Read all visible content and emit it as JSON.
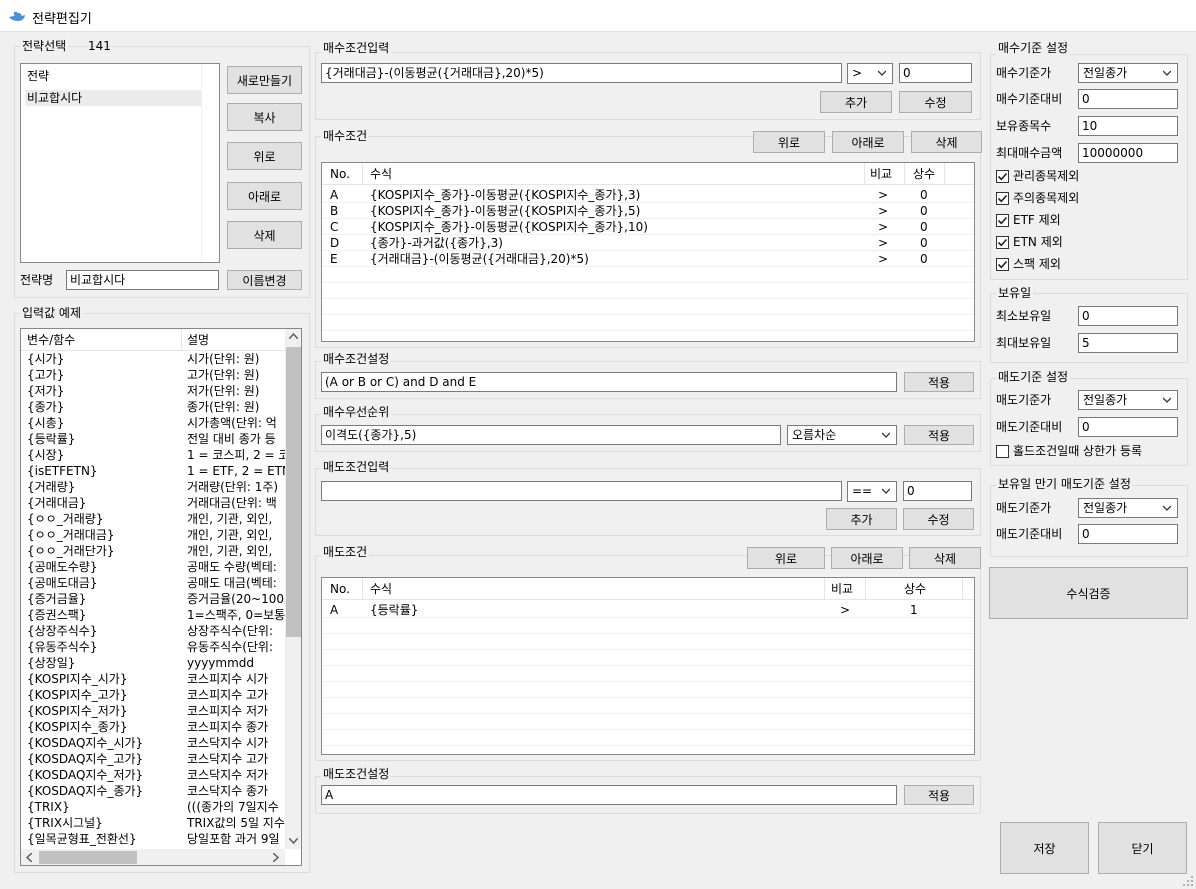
{
  "window": {
    "title": "전략편집기"
  },
  "strategy": {
    "group_label": "전략선택",
    "count": "141",
    "list_header": "전략",
    "items": [
      "비교합시다"
    ],
    "name_label": "전략명",
    "name_value": "비교합시다",
    "buttons": {
      "new": "새로만들기",
      "copy": "복사",
      "up": "위로",
      "down": "아래로",
      "delete": "삭제",
      "rename": "이름변경"
    }
  },
  "examples": {
    "group_label": "입력값 예제",
    "columns": [
      "변수/함수",
      "설명"
    ],
    "rows": [
      [
        "{시가}",
        "시가(단위: 원)"
      ],
      [
        "{고가}",
        "고가(단위: 원)"
      ],
      [
        "{저가}",
        "저가(단위: 원)"
      ],
      [
        "{종가}",
        "종가(단위: 원)"
      ],
      [
        "{시총}",
        "시가총액(단위: 억"
      ],
      [
        "{등락률}",
        "전일 대비 종가 등"
      ],
      [
        "{시장}",
        "1 = 코스피, 2 = 코"
      ],
      [
        "{isETFETN}",
        "1 = ETF, 2 = ETN"
      ],
      [
        "{거래량}",
        "거래량(단위: 1주)"
      ],
      [
        "{거래대금}",
        "거래대금(단위: 백"
      ],
      [
        "{ㅇㅇ_거래량}",
        "개인, 기관, 외인,"
      ],
      [
        "{ㅇㅇ_거래대금}",
        "개인, 기관, 외인,"
      ],
      [
        "{ㅇㅇ_거래단가}",
        "개인, 기관, 외인,"
      ],
      [
        "{공매도수량}",
        "공매도 수량(벡테:"
      ],
      [
        "{공매도대금}",
        "공매도 대금(벡테:"
      ],
      [
        "{증거금율}",
        "증거금율(20~100)"
      ],
      [
        "{증권스팩}",
        "1=스팩주, 0=보통:"
      ],
      [
        "{상장주식수}",
        "상장주식수(단위:"
      ],
      [
        "{유동주식수}",
        "유동주식수(단위:"
      ],
      [
        "{상장일}",
        "yyyymmdd"
      ],
      [
        "{KOSPI지수_시가}",
        "코스피지수 시가"
      ],
      [
        "{KOSPI지수_고가}",
        "코스피지수 고가"
      ],
      [
        "{KOSPI지수_저가}",
        "코스피지수 저가"
      ],
      [
        "{KOSPI지수_종가}",
        "코스피지수 종가"
      ],
      [
        "{KOSDAQ지수_시가}",
        "코스닥지수 시가"
      ],
      [
        "{KOSDAQ지수_고가}",
        "코스닥지수 고가"
      ],
      [
        "{KOSDAQ지수_저가}",
        "코스닥지수 저가"
      ],
      [
        "{KOSDAQ지수_종가}",
        "코스닥지수 종가"
      ],
      [
        "{TRIX}",
        "(((종가의 7일지수"
      ],
      [
        "{TRIX시그널}",
        "TRIX값의 5일 지수"
      ],
      [
        "{일목균형표_전환선}",
        "당일포함 과거 9일"
      ]
    ]
  },
  "buy_input": {
    "group_label": "매수조건입력",
    "expression": "{거래대금}-(이동평균({거래대금},20)*5)",
    "operator": ">",
    "constant": "0",
    "add": "추가",
    "edit": "수정"
  },
  "buy_conditions": {
    "group_label": "매수조건",
    "up": "위로",
    "down": "아래로",
    "delete": "삭제",
    "columns": [
      "No.",
      "수식",
      "비교",
      "상수"
    ],
    "rows": [
      [
        "A",
        "{KOSPI지수_종가}-이동평균({KOSPI지수_종가},3)",
        ">",
        "0"
      ],
      [
        "B",
        "{KOSPI지수_종가}-이동평균({KOSPI지수_종가},5)",
        ">",
        "0"
      ],
      [
        "C",
        "{KOSPI지수_종가}-이동평균({KOSPI지수_종가},10)",
        ">",
        "0"
      ],
      [
        "D",
        "{종가}-과거값({종가},3)",
        ">",
        "0"
      ],
      [
        "E",
        "{거래대금}-(이동평균({거래대금},20)*5)",
        ">",
        "0"
      ]
    ]
  },
  "buy_setting": {
    "group_label": "매수조건설정",
    "value": "(A or B or C) and D and E",
    "apply": "적용"
  },
  "buy_priority": {
    "group_label": "매수우선순위",
    "value": "이격도({종가},5)",
    "order": "오름차순",
    "apply": "적용"
  },
  "sell_input": {
    "group_label": "매도조건입력",
    "expression": "",
    "operator": "==",
    "constant": "0",
    "add": "추가",
    "edit": "수정"
  },
  "sell_conditions": {
    "group_label": "매도조건",
    "up": "위로",
    "down": "아래로",
    "delete": "삭제",
    "columns": [
      "No.",
      "수식",
      "비교",
      "상수"
    ],
    "rows": [
      [
        "A",
        "{등락률}",
        ">",
        "1"
      ]
    ]
  },
  "sell_setting": {
    "group_label": "매도조건설정",
    "value": "A",
    "apply": "적용"
  },
  "buy_criteria": {
    "group_label": "매수기준 설정",
    "price_label": "매수기준가",
    "price_value": "전일종가",
    "ratio_label": "매수기준대비",
    "ratio_value": "0",
    "holdings_label": "보유종목수",
    "holdings_value": "10",
    "max_amount_label": "최대매수금액",
    "max_amount_value": "10000000",
    "checks": [
      "관리종목제외",
      "주의종목제외",
      "ETF 제외",
      "ETN 제외",
      "스팩 제외"
    ]
  },
  "holding": {
    "group_label": "보유일",
    "min_label": "최소보유일",
    "min_value": "0",
    "max_label": "최대보유일",
    "max_value": "5"
  },
  "sell_criteria": {
    "group_label": "매도기준 설정",
    "price_label": "매도기준가",
    "price_value": "전일종가",
    "ratio_label": "매도기준대비",
    "ratio_value": "0",
    "hold_check": "홀드조건일때 상한가 등록"
  },
  "expiry": {
    "group_label": "보유일 만기 매도기준 설정",
    "price_label": "매도기준가",
    "price_value": "전일종가",
    "ratio_label": "매도기준대비",
    "ratio_value": "0"
  },
  "actions": {
    "verify": "수식검증",
    "save": "저장",
    "close": "닫기"
  }
}
